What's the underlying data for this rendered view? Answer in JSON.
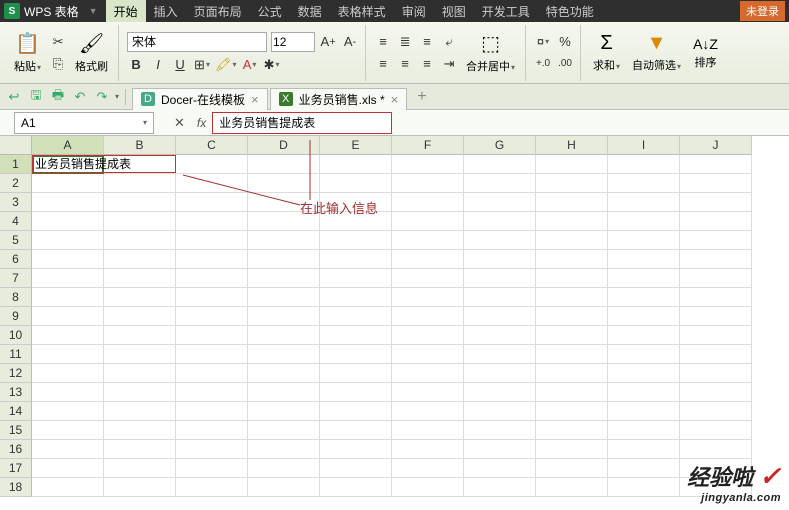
{
  "app": {
    "logo": "S",
    "name": "WPS 表格",
    "login": "未登录"
  },
  "menu": {
    "items": [
      "开始",
      "插入",
      "页面布局",
      "公式",
      "数据",
      "表格样式",
      "审阅",
      "视图",
      "开发工具",
      "特色功能"
    ],
    "active": 0
  },
  "ribbon": {
    "paste": "粘贴",
    "format_painter": "格式刷",
    "font_name": "宋体",
    "font_size": "12",
    "merge_center": "合并居中",
    "sum": "求和",
    "filter": "自动筛选",
    "sort": "排序"
  },
  "qa": {
    "icons": [
      "↩",
      "🖫",
      "🖶",
      "↶",
      "↷"
    ]
  },
  "doc_tabs": [
    {
      "icon_bg": "#4a8",
      "icon": "D",
      "label": "Docer-在线模板"
    },
    {
      "icon_bg": "#3a7a2a",
      "icon": "X",
      "label": "业务员销售.xls *"
    }
  ],
  "cell_ref": "A1",
  "formula_value": "业务员销售提成表",
  "columns": [
    "A",
    "B",
    "C",
    "D",
    "E",
    "F",
    "G",
    "H",
    "I",
    "J"
  ],
  "row_count": 18,
  "active_cell_text": "业务员销售提成表",
  "annotation": "在此输入信息",
  "watermark": {
    "line1_a": "经验啦",
    "line1_b": "✓",
    "line2": "jingyanla.com"
  }
}
